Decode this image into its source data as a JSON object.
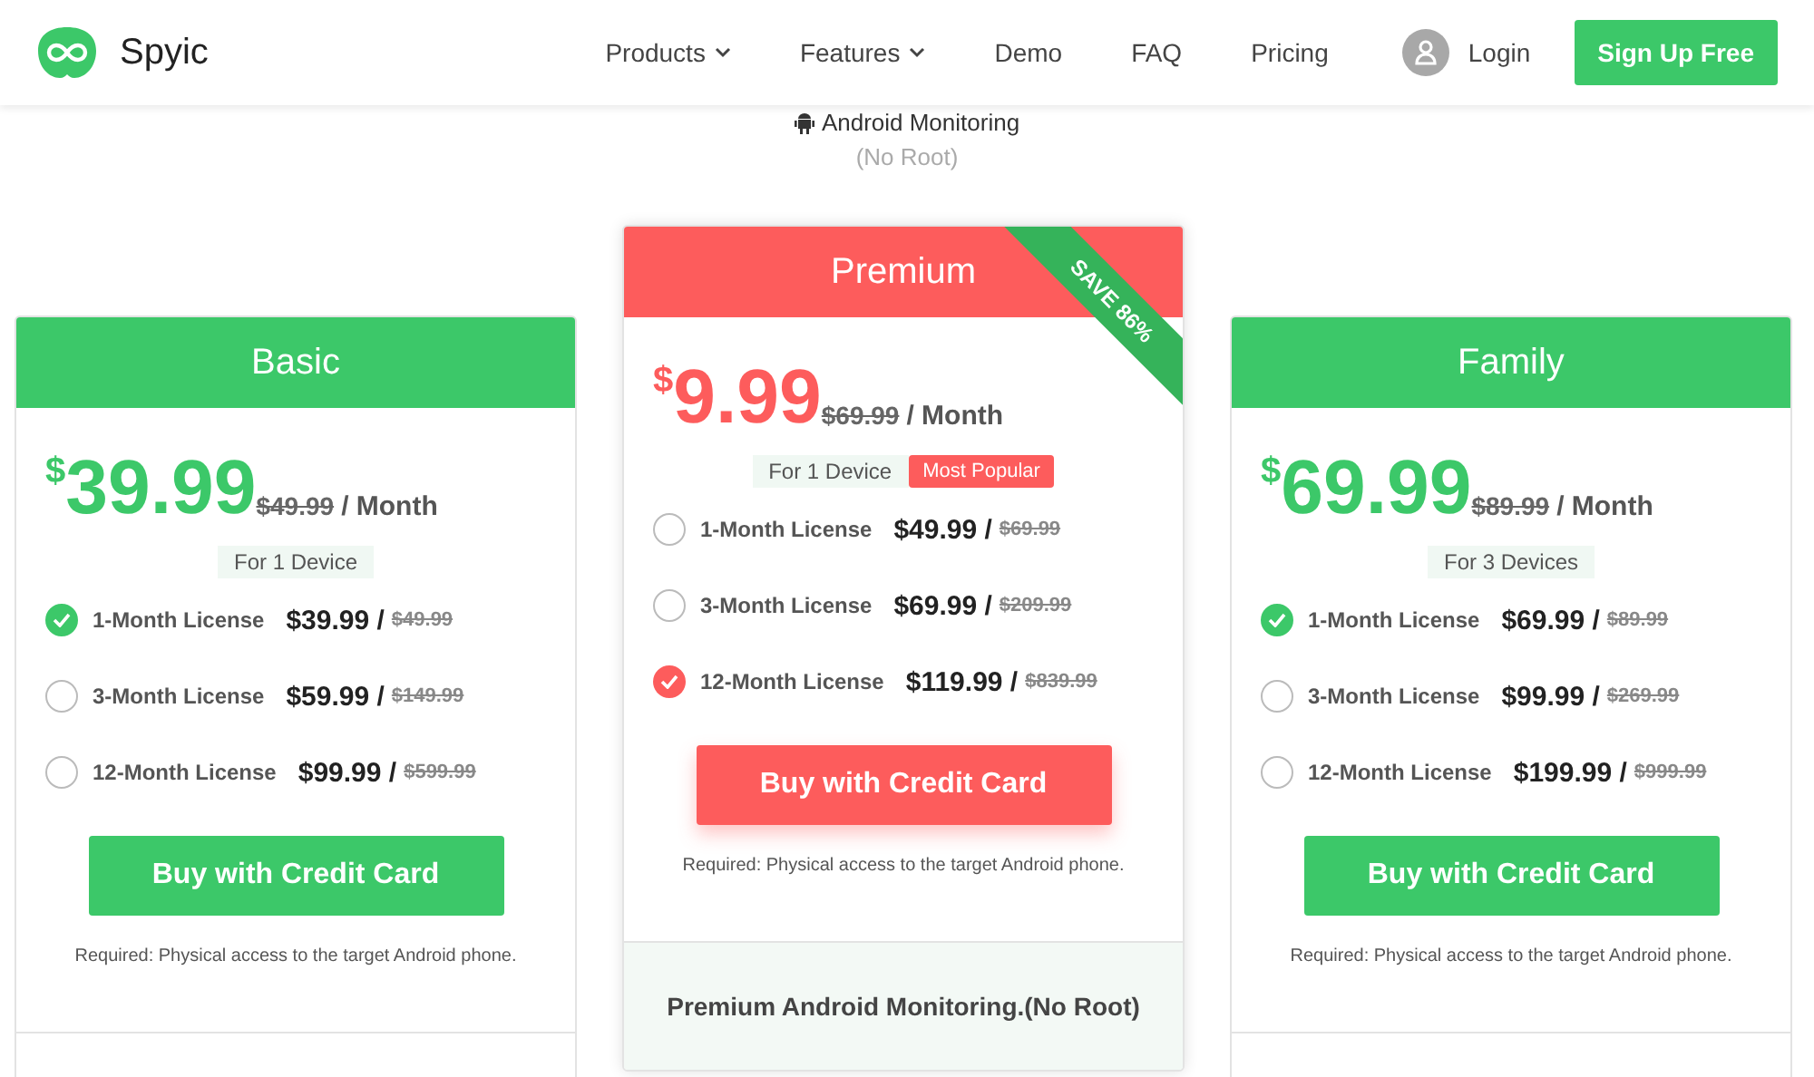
{
  "header": {
    "brand": "Spyic",
    "nav": [
      {
        "label": "Products",
        "dropdown": true
      },
      {
        "label": "Features",
        "dropdown": true
      },
      {
        "label": "Demo",
        "dropdown": false
      },
      {
        "label": "FAQ",
        "dropdown": false
      },
      {
        "label": "Pricing",
        "dropdown": false
      }
    ],
    "login": "Login",
    "signup": "Sign Up Free"
  },
  "intro": {
    "title": "Android Monitoring",
    "subtitle": "(No Root)"
  },
  "plans": [
    {
      "name": "Basic",
      "featured": false,
      "color": "#3cc869",
      "currency": "$",
      "price": "39.99",
      "old_price": "$49.99",
      "per": "/ Month",
      "devices": "For 1 Device",
      "options": [
        {
          "label": "1-Month License",
          "price": "$39.99 /",
          "old_price": "$49.99",
          "selected": true
        },
        {
          "label": "3-Month License",
          "price": "$59.99 /",
          "old_price": "$149.99",
          "selected": false
        },
        {
          "label": "12-Month License",
          "price": "$99.99 /",
          "old_price": "$599.99",
          "selected": false
        }
      ],
      "button": "Buy with Credit Card",
      "note": "Required: Physical access to the target Android phone."
    },
    {
      "name": "Premium",
      "featured": true,
      "color": "#fd5c5c",
      "ribbon": "SAVE 86%",
      "currency": "$",
      "price": "9.99",
      "old_price": "$69.99",
      "per": "/ Month",
      "devices": "For 1 Device",
      "badge": "Most Popular",
      "options": [
        {
          "label": "1-Month License",
          "price": "$49.99 /",
          "old_price": "$69.99",
          "selected": false
        },
        {
          "label": "3-Month License",
          "price": "$69.99 /",
          "old_price": "$209.99",
          "selected": false
        },
        {
          "label": "12-Month License",
          "price": "$119.99 /",
          "old_price": "$839.99",
          "selected": true
        }
      ],
      "button": "Buy with Credit Card",
      "note": "Required: Physical access to the target Android phone.",
      "footer": "Premium Android Monitoring.(No Root)"
    },
    {
      "name": "Family",
      "featured": false,
      "color": "#3cc869",
      "currency": "$",
      "price": "69.99",
      "old_price": "$89.99",
      "per": "/ Month",
      "devices": "For 3 Devices",
      "options": [
        {
          "label": "1-Month License",
          "price": "$69.99 /",
          "old_price": "$89.99",
          "selected": true
        },
        {
          "label": "3-Month License",
          "price": "$99.99 /",
          "old_price": "$269.99",
          "selected": false
        },
        {
          "label": "12-Month License",
          "price": "$199.99 /",
          "old_price": "$999.99",
          "selected": false
        }
      ],
      "button": "Buy with Credit Card",
      "note": "Required: Physical access to the target Android phone."
    }
  ]
}
